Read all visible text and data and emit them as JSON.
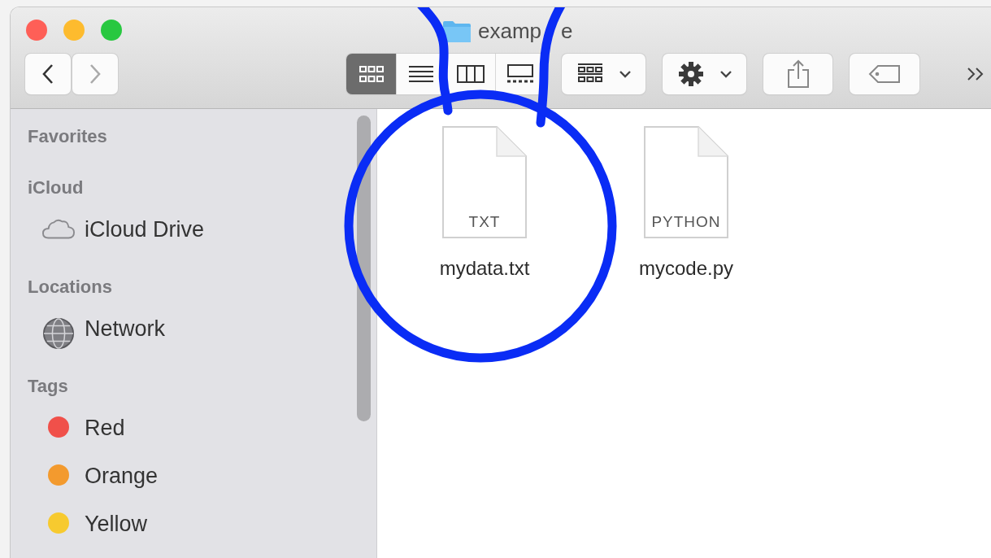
{
  "window": {
    "title": "examp",
    "title_tail": "e"
  },
  "toolbar": {
    "nav": [
      {
        "kind": "back",
        "disabled": false
      },
      {
        "kind": "forward",
        "disabled": true
      }
    ],
    "view_modes": [
      {
        "kind": "icons",
        "selected": true
      },
      {
        "kind": "list",
        "selected": false
      },
      {
        "kind": "columns",
        "selected": false
      },
      {
        "kind": "gallery",
        "selected": false
      }
    ],
    "buttons": [
      {
        "kind": "group"
      },
      {
        "kind": "action"
      },
      {
        "kind": "share"
      },
      {
        "kind": "tags"
      }
    ]
  },
  "sidebar": {
    "sections": [
      {
        "title": "Favorites"
      },
      {
        "title": "iCloud",
        "items": [
          {
            "kind": "cloud",
            "label": "iCloud Drive"
          }
        ]
      },
      {
        "title": "Locations",
        "items": [
          {
            "kind": "network",
            "label": "Network"
          }
        ]
      },
      {
        "title": "Tags",
        "items": [
          {
            "kind": "tag",
            "label": "Red",
            "color": "#f0504a"
          },
          {
            "kind": "tag",
            "label": "Orange",
            "color": "#f39a2e"
          },
          {
            "kind": "tag",
            "label": "Yellow",
            "color": "#f7ca2f"
          }
        ]
      }
    ]
  },
  "files": [
    {
      "name": "mydata.txt",
      "badge": "TXT"
    },
    {
      "name": "mycode.py",
      "badge": "PYTHON"
    }
  ]
}
